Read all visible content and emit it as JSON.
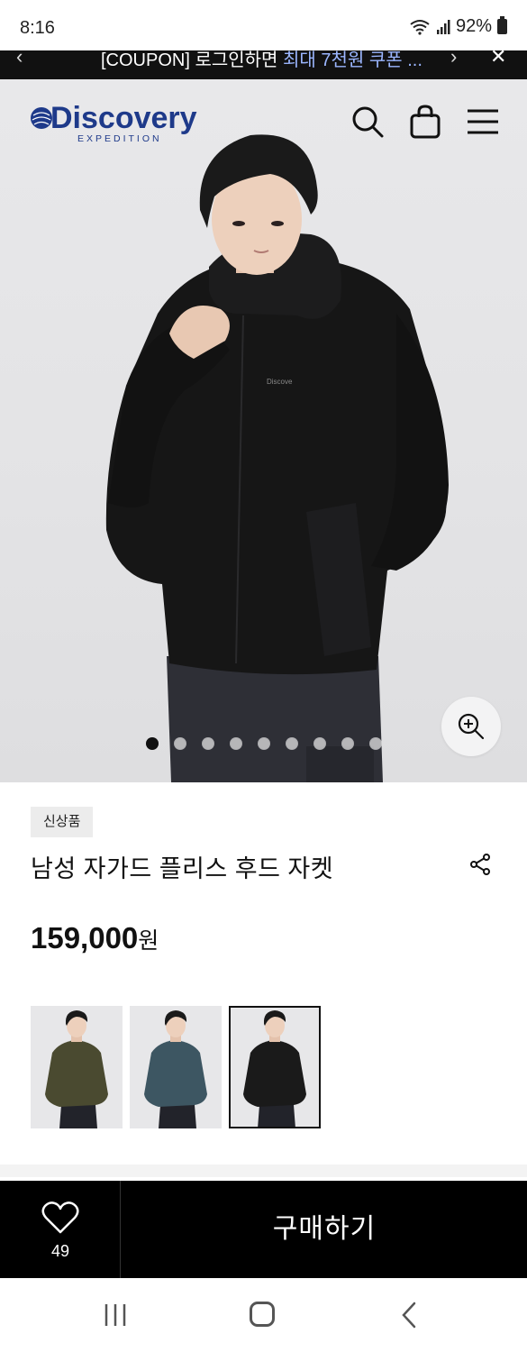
{
  "status": {
    "time": "8:16",
    "battery": "92%"
  },
  "coupon": {
    "prefix": "[COUPON] 로그인하면 ",
    "highlight": "최대 7천원 쿠폰 ..."
  },
  "brand": {
    "name": "Discovery",
    "sub": "EXPEDITION"
  },
  "gallery": {
    "total": 9,
    "active": 0
  },
  "product": {
    "badge": "신상품",
    "name": "남성 자가드 플리스 후드 자켓",
    "price": "159,000",
    "price_unit": "원"
  },
  "swatches": [
    {
      "color": "#4a4a30",
      "label": "olive"
    },
    {
      "color": "#3d5662",
      "label": "slate blue"
    },
    {
      "color": "#1a1a1a",
      "label": "black"
    }
  ],
  "wishlist": {
    "count": "49"
  },
  "buy": {
    "label": "구매하기"
  }
}
